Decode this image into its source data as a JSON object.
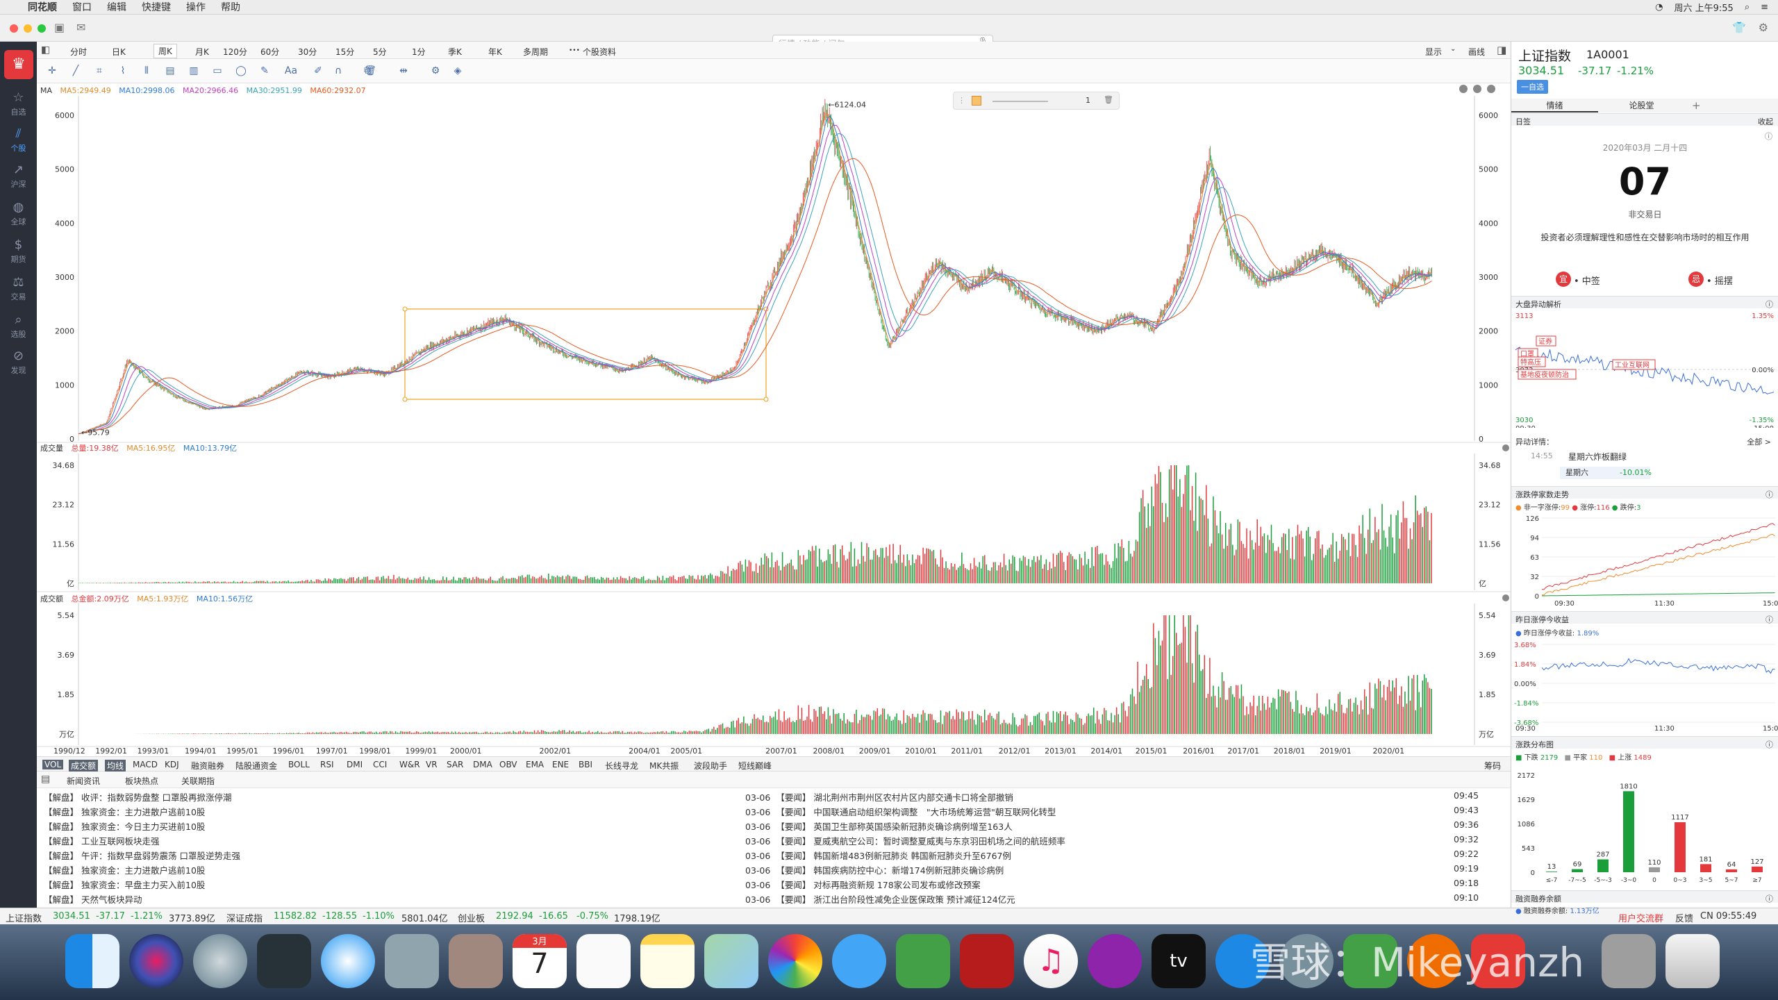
{
  "menubar": {
    "app": "同花顺",
    "items": [
      "窗口",
      "编辑",
      "快捷键",
      "操作",
      "帮助"
    ],
    "clock": "周六 上午9:55"
  },
  "search": {
    "placeholder": "行情 / 功能 / 问句"
  },
  "sidebar": {
    "items": [
      "自选",
      "个股",
      "沪深",
      "全球",
      "期货",
      "交易",
      "选股",
      "发现"
    ]
  },
  "periods": [
    "分时",
    "日K",
    "周K",
    "月K",
    "120分",
    "60分",
    "30分",
    "15分",
    "5分",
    "1分",
    "季K",
    "年K",
    "多周期",
    "个股资料"
  ],
  "period_active": "周K",
  "period_right": {
    "display": "显示",
    "draw": "画线"
  },
  "ma_legend": {
    "label": "MA",
    "ma5": "MA5:2949.49",
    "ma10": "MA10:2998.06",
    "ma20": "MA20:2966.46",
    "ma30": "MA30:2951.99",
    "ma60": "MA60:2932.07"
  },
  "vol_legend": {
    "label": "成交量",
    "total": "总量:19.38亿",
    "ma5": "MA5:16.95亿",
    "ma10": "MA10:13.79亿"
  },
  "amt_legend": {
    "label": "成交额",
    "total": "总金额:2.09万亿",
    "ma5": "MA5:1.93万亿",
    "ma10": "MA10:1.56万亿"
  },
  "annot": {
    "high": "6124.04",
    "low": "95.79",
    "slider_val": "1"
  },
  "axis_units": {
    "vol": "亿",
    "amt": "万亿"
  },
  "chart_data": [
    {
      "type": "line",
      "title": "",
      "ylim": [
        0,
        6400
      ],
      "yticks": [
        0,
        1000,
        2000,
        3000,
        4000,
        5000,
        6000
      ],
      "x": [
        "1990/12",
        "1992/01",
        "1993/01",
        "1994/01",
        "1995/01",
        "1996/01",
        "1997/01",
        "1998/01",
        "1999/01",
        "2000/01",
        "2002/01",
        "2004/01",
        "2005/01",
        "2007/01",
        "2008/01",
        "2009/01",
        "2010/01",
        "2011/01",
        "2012/01",
        "2013/01",
        "2014/01",
        "2015/01",
        "2016/01",
        "2017/01",
        "2018/01",
        "2019/01",
        "2020/01"
      ],
      "series": [
        {
          "name": "",
          "values": [
            100,
            300,
            1450,
            800,
            650,
            600,
            1000,
            1250,
            1300,
            1600,
            1600,
            1200,
            1100,
            2700,
            5500,
            2000,
            3200,
            2800,
            2300,
            2200,
            2100,
            3200,
            3000,
            3100,
            3300,
            2500,
            3034
          ]
        }
      ]
    },
    {
      "type": "bar",
      "title": "",
      "ylim": [
        0,
        34.68
      ],
      "yticks": [
        11.56,
        23.12,
        34.68
      ],
      "values": [
        0.1,
        0.2,
        0.4,
        0.5,
        0.6,
        1.2,
        1.8,
        1.5,
        1.4,
        2.2,
        1.5,
        1.6,
        1.8,
        6,
        8,
        9,
        8,
        7,
        6,
        7,
        9,
        34,
        15,
        13,
        12,
        17,
        19.38
      ]
    },
    {
      "type": "bar",
      "title": "",
      "ylim": [
        0,
        5.54
      ],
      "yticks": [
        1.85,
        3.69,
        5.54
      ],
      "values": [
        0,
        0,
        0.02,
        0.03,
        0.04,
        0.08,
        0.1,
        0.09,
        0.08,
        0.15,
        0.1,
        0.1,
        0.12,
        0.8,
        1.0,
        0.9,
        0.8,
        0.9,
        0.7,
        0.8,
        1.0,
        5.54,
        1.9,
        1.5,
        1.4,
        1.9,
        2.09
      ]
    }
  ],
  "xlabels": [
    "1990/12",
    "1992/01",
    "1993/01",
    "1994/01",
    "1995/01",
    "1996/01",
    "1997/01",
    "1998/01",
    "1999/01",
    "2000/01",
    "2002/01",
    "2004/01",
    "2005/01",
    "2007/01",
    "2008/01",
    "2009/01",
    "2010/01",
    "2011/01",
    "2012/01",
    "2013/01",
    "2014/01",
    "2015/01",
    "2016/01",
    "2017/01",
    "2018/01",
    "2019/01",
    "2020/01"
  ],
  "indicators": [
    "VOL",
    "成交额",
    "均线",
    "MACD",
    "KDJ",
    "融资融券",
    "陆股通资金",
    "BOLL",
    "RSI",
    "DMI",
    "CCI",
    "W&R",
    "VR",
    "SAR",
    "DMA",
    "OBV",
    "EMA",
    "ENE",
    "BBI",
    "长线寻龙",
    "MK共振",
    "波段助手",
    "短线巅峰"
  ],
  "indicators_right": "筹码",
  "newstabs": [
    "新闻资讯",
    "板块热点",
    "关联期指"
  ],
  "news_left": [
    {
      "tag": "【解盘】",
      "title": "收评：指数弱势盘整 口罩股再掀涨停潮"
    },
    {
      "tag": "【解盘】",
      "title": "独家资金：主力进散户逃前10股"
    },
    {
      "tag": "【解盘】",
      "title": "独家资金：今日主力买进前10股"
    },
    {
      "tag": "【解盘】",
      "title": "工业互联网板块走强"
    },
    {
      "tag": "【解盘】",
      "title": "午评：指数早盘弱势震荡 口罩股逆势走强"
    },
    {
      "tag": "【解盘】",
      "title": "独家资金：主力进散户逃前10股"
    },
    {
      "tag": "【解盘】",
      "title": "独家资金：早盘主力买入前10股"
    },
    {
      "tag": "【解盘】",
      "title": "天然气板块异动"
    }
  ],
  "news_right": [
    {
      "date": "03-06",
      "tag": "【要闻】",
      "title": "湖北荆州市荆州区农村片区内部交通卡口将全部撤销",
      "time": "09:45"
    },
    {
      "date": "03-06",
      "tag": "【要闻】",
      "title": "中国联通启动组织架构调整　\"大市场统筹运营\"朝互联网化转型",
      "time": "09:43"
    },
    {
      "date": "03-06",
      "tag": "【要闻】",
      "title": "英国卫生部称英国感染新冠肺炎确诊病例增至163人",
      "time": "09:36"
    },
    {
      "date": "03-06",
      "tag": "【要闻】",
      "title": "夏威夷航空公司：暂时调整夏威夷与东京羽田机场之间的航班频率",
      "time": "09:32"
    },
    {
      "date": "03-06",
      "tag": "【要闻】",
      "title": "韩国新增483例新冠肺炎 韩国新冠肺炎升至6767例",
      "time": "09:22"
    },
    {
      "date": "03-06",
      "tag": "【要闻】",
      "title": "韩国疾病防控中心：新增174例新冠肺炎确诊病例",
      "time": "09:19"
    },
    {
      "date": "03-06",
      "tag": "【要闻】",
      "title": "对标再融资新规 178家公司发布或修改预案",
      "time": "09:18"
    },
    {
      "date": "03-06",
      "tag": "【要闻】",
      "title": "浙江出台阶段性减免企业医保政策 预计减征124亿元",
      "time": "09:10"
    }
  ],
  "status": {
    "sh_name": "上证指数",
    "sh_val": "3034.51",
    "sh_chg": "-37.17",
    "sh_pct": "-1.21%",
    "sh_amt": "3773.89亿",
    "sz_name": "深证成指",
    "sz_val": "11582.82",
    "sz_chg": "-128.55",
    "sz_pct": "-1.10%",
    "sz_amt": "5801.04亿",
    "cy_name": "创业板",
    "cy_val": "2192.94",
    "cy_chg": "-16.65",
    "cy_pct": "-0.75%",
    "cy_amt": "1798.19亿",
    "user_group": "用户交流群",
    "feedback": "反馈",
    "clock": "CN 09:55:49"
  },
  "right": {
    "name": "上证指数",
    "code": "1A0001",
    "price": "3034.51",
    "chg": "-37.17",
    "pct": "-1.21%",
    "add": "一自选",
    "tabs": [
      "情绪",
      "论股堂"
    ],
    "cal_label": "日签",
    "collapse": "收起",
    "date": "2020年03月 二月十四",
    "day": "07",
    "nontrade": "非交易日",
    "quote": "投资者必须理解理性和感性在交替影响市场时的相互作用",
    "yi": "宜",
    "yi_text": "• 中签",
    "ji": "忌",
    "ji_text": "• 摇摆",
    "abn_title": "大盘异动解析",
    "abn_top": "3113",
    "abn_mid": "3072",
    "abn_bot": "3030",
    "abn_p1": "1.35%",
    "abn_p2": "0.00%",
    "abn_p3": "-1.35%",
    "abn_t1": "09:30",
    "abn_t2": "15:00",
    "abn_tags": [
      "证券",
      "口罩",
      "特高压",
      "基地疫夜顿防治",
      "工业互联网"
    ],
    "abn_detail": "异动详情：",
    "abn_all": "全部 >",
    "abn_time": "14:55",
    "abn_event": "星期六炸板翻绿",
    "abn_day": "星期六",
    "abn_pct": "-10.01%",
    "zt_title": "涨跌停家数走势",
    "zt_legend": [
      "非一字涨停:",
      "99",
      "涨停:",
      "116",
      "跌停:",
      "3"
    ],
    "zt_y": [
      "126",
      "94",
      "63",
      "32",
      "0"
    ],
    "zt_x": [
      "09:30",
      "11:30",
      "15:00"
    ],
    "yz_title": "昨日涨停今收益",
    "yz_legend": "昨日涨停今收益:",
    "yz_val": "1.89%",
    "yz_y": [
      "3.68%",
      "1.84%",
      "0.00%",
      "-1.84%",
      "-3.68%"
    ],
    "yz_x": [
      "09:30",
      "11:30",
      "15:00"
    ],
    "dist_title": "涨跌分布图",
    "dist_legend": [
      "下跌",
      "2179",
      "平家",
      "110",
      "上涨",
      "1489"
    ],
    "dist_y": [
      "2172",
      "1629",
      "1086",
      "543",
      "0"
    ],
    "dist_cats": [
      "≤-7",
      "-7~-5",
      "-5~-3",
      "-3~0",
      "0",
      "0~3",
      "3~5",
      "5~7",
      "≥7"
    ],
    "dist_vals": [
      13,
      69,
      287,
      1810,
      110,
      1117,
      181,
      64,
      127
    ],
    "rz_title": "融资融券余额",
    "rz_legend": "融资融券余额:",
    "rz_val": "1.13万亿"
  },
  "dock": {
    "calendar_month": "3月",
    "calendar_day": "7",
    "watermark": "雪球：Mikeyanzh"
  }
}
